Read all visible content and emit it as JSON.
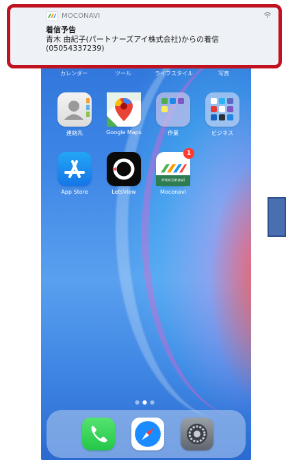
{
  "notification": {
    "app_name": "MOCONAVI",
    "title": "着信予告",
    "line1": "青木 由紀子(パートナーズアイ株式会社)からの着信",
    "line2": "(05054337239)",
    "icon": "moconavi-mini-icon",
    "signal_icon": "network-icon"
  },
  "peek_labels": [
    "カレンダー",
    "ツール",
    "ライフスタイル",
    "写真"
  ],
  "apps_row1": [
    {
      "label": "連絡先",
      "icon": "contacts-icon"
    },
    {
      "label": "Google Maps",
      "icon": "google-maps-icon"
    },
    {
      "label": "作業",
      "icon": "folder-icon"
    },
    {
      "label": "ビジネス",
      "icon": "folder-icon"
    }
  ],
  "apps_row2": [
    {
      "label": "App Store",
      "icon": "app-store-icon"
    },
    {
      "label": "LetsView",
      "icon": "letsview-icon"
    },
    {
      "label": "Moconavi",
      "icon": "moconavi-icon",
      "badge": "1",
      "sub": "moconavi"
    }
  ],
  "dock": [
    {
      "icon": "phone-icon"
    },
    {
      "icon": "safari-icon"
    },
    {
      "icon": "settings-icon"
    }
  ],
  "colors": {
    "highlight": "#c1121f",
    "badge": "#ff3b30",
    "phone_green": "#2fd15a",
    "safari_blue": "#1a8cff"
  }
}
